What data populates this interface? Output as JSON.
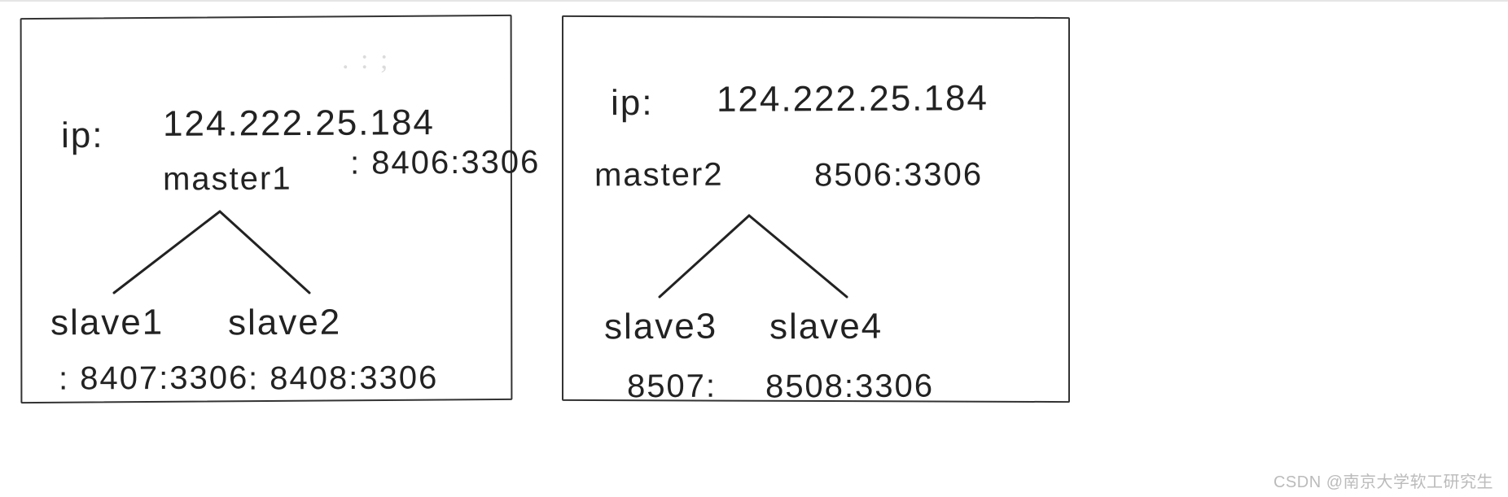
{
  "left": {
    "ip_label": "ip:",
    "ip_value": "124.222.25.184",
    "master_name": "master1",
    "master_port": ": 8406:3306",
    "slave1_name": "slave1",
    "slave1_port": ": 8407:3306",
    "slave2_name": "slave2",
    "slave2_port": ": 8408:3306"
  },
  "right": {
    "ip_label": "ip:",
    "ip_value": "124.222.25.184",
    "master_name": "master2",
    "master_port": "8506:3306",
    "slave3_name": "slave3",
    "slave3_port": "8507:",
    "slave4_name": "slave4",
    "slave4_port": "8508:3306"
  },
  "watermark": "CSDN @南京大学软工研究生",
  "scribble_left": ". :  ;",
  "scribble_right": " "
}
